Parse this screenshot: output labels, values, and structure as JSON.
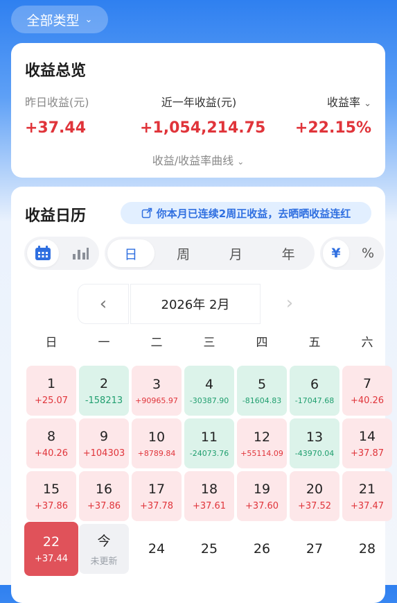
{
  "filter": {
    "label": "全部类型"
  },
  "overview": {
    "title": "收益总览",
    "yesterday_label": "昨日收益(元)",
    "yesterday_value": "+37.44",
    "year_label": "近一年收益(元)",
    "year_value": "+1,054,214.75",
    "rate_label": "收益率",
    "rate_value": "+22.15%",
    "curve_link": "收益/收益率曲线"
  },
  "calendar": {
    "title": "收益日历",
    "banner": "你本月已连续2周正收益，去晒晒收益连红",
    "view_options": [
      "calendar-icon",
      "bar-chart-icon"
    ],
    "periods": [
      "日",
      "周",
      "月",
      "年"
    ],
    "units": [
      "¥",
      "%"
    ],
    "month_label": "2026年 2月",
    "weekdays": [
      "日",
      "一",
      "二",
      "三",
      "四",
      "五",
      "六"
    ],
    "days": [
      {
        "d": "1",
        "v": "+25.07",
        "t": "pos"
      },
      {
        "d": "2",
        "v": "-158213",
        "t": "neg"
      },
      {
        "d": "3",
        "v": "+90965.97",
        "t": "pos",
        "small": true
      },
      {
        "d": "4",
        "v": "-30387.90",
        "t": "neg",
        "small": true
      },
      {
        "d": "5",
        "v": "-81604.83",
        "t": "neg",
        "small": true
      },
      {
        "d": "6",
        "v": "-17047.68",
        "t": "neg",
        "small": true
      },
      {
        "d": "7",
        "v": "+40.26",
        "t": "pos"
      },
      {
        "d": "8",
        "v": "+40.26",
        "t": "pos"
      },
      {
        "d": "9",
        "v": "+104303",
        "t": "pos"
      },
      {
        "d": "10",
        "v": "+8789.84",
        "t": "pos",
        "small": true
      },
      {
        "d": "11",
        "v": "-24073.76",
        "t": "neg",
        "small": true
      },
      {
        "d": "12",
        "v": "+55114.09",
        "t": "pos",
        "small": true
      },
      {
        "d": "13",
        "v": "-43970.04",
        "t": "neg",
        "small": true
      },
      {
        "d": "14",
        "v": "+37.87",
        "t": "pos"
      },
      {
        "d": "15",
        "v": "+37.86",
        "t": "pos"
      },
      {
        "d": "16",
        "v": "+37.86",
        "t": "pos"
      },
      {
        "d": "17",
        "v": "+37.78",
        "t": "pos"
      },
      {
        "d": "18",
        "v": "+37.61",
        "t": "pos"
      },
      {
        "d": "19",
        "v": "+37.60",
        "t": "pos"
      },
      {
        "d": "20",
        "v": "+37.52",
        "t": "pos"
      },
      {
        "d": "21",
        "v": "+37.47",
        "t": "pos"
      },
      {
        "d": "22",
        "v": "+37.44",
        "t": "sel"
      },
      {
        "d": "今",
        "v": "未更新",
        "t": "today"
      },
      {
        "d": "24",
        "v": "",
        "t": "future"
      },
      {
        "d": "25",
        "v": "",
        "t": "future"
      },
      {
        "d": "26",
        "v": "",
        "t": "future"
      },
      {
        "d": "27",
        "v": "",
        "t": "future"
      },
      {
        "d": "28",
        "v": "",
        "t": "future"
      }
    ]
  },
  "colors": {
    "primary": "#2f6fe0",
    "positive": "#e0343a",
    "negative": "#1f9e6e"
  }
}
